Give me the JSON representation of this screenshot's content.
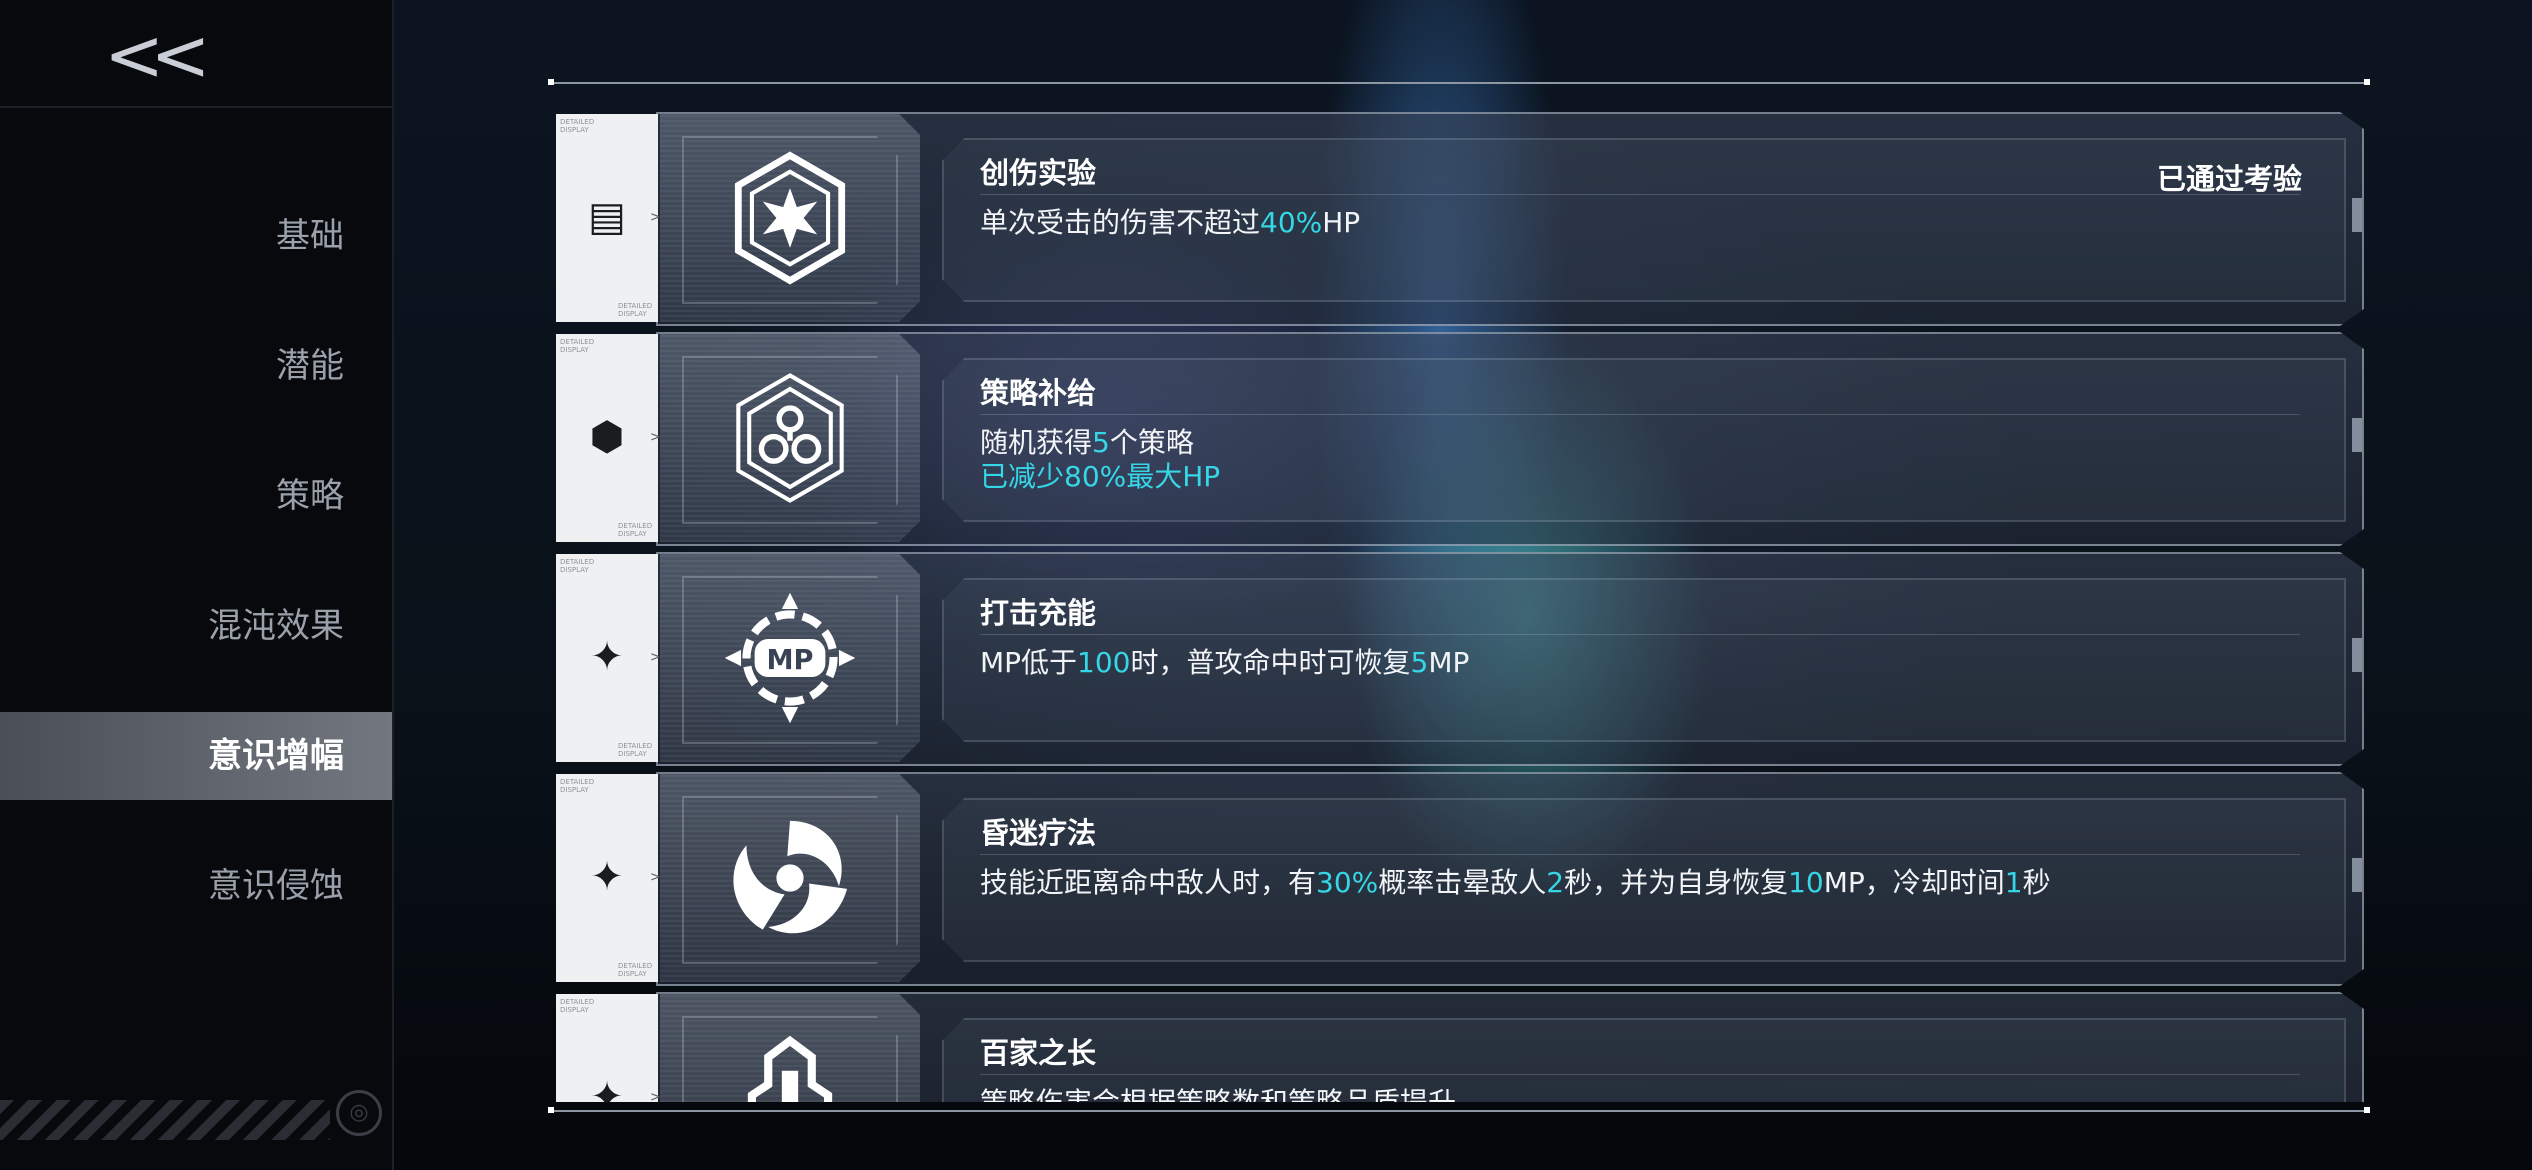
{
  "nav": {
    "back_label": "<<",
    "items": [
      {
        "label": "基础"
      },
      {
        "label": "潜能"
      },
      {
        "label": "策略"
      },
      {
        "label": "混沌效果"
      },
      {
        "label": "意识增幅",
        "active": true
      },
      {
        "label": "意识侵蚀"
      }
    ]
  },
  "tag": {
    "top_label": "DETAILED DISPLAY",
    "bottom_label": "DETAILED DISPLAY"
  },
  "cards": [
    {
      "title": "创伤实验",
      "status": "已通过考验",
      "desc1": [
        "单次受击的伤害不超过",
        "40%",
        "HP"
      ]
    },
    {
      "title": "策略补给",
      "desc1": [
        "随机获得",
        "5",
        "个策略"
      ],
      "desc2": "已减少80%最大HP"
    },
    {
      "title": "打击充能",
      "desc1": [
        "MP低于",
        "100",
        "时，普攻命中时可恢复",
        "5",
        "MP"
      ]
    },
    {
      "title": "昏迷疗法",
      "desc1": [
        "技能近距离命中敌人时，有",
        "30%",
        "概率击晕敌人",
        "2",
        "秒，并为自身恢复",
        "10",
        "MP，冷却时间",
        "1",
        "秒"
      ]
    },
    {
      "title": "百家之长",
      "desc1": [
        "策略伤害会根据策略数和策略品质提升"
      ]
    }
  ],
  "colors": {
    "highlight": "#35d6e6",
    "active_nav": "#6d727a"
  }
}
